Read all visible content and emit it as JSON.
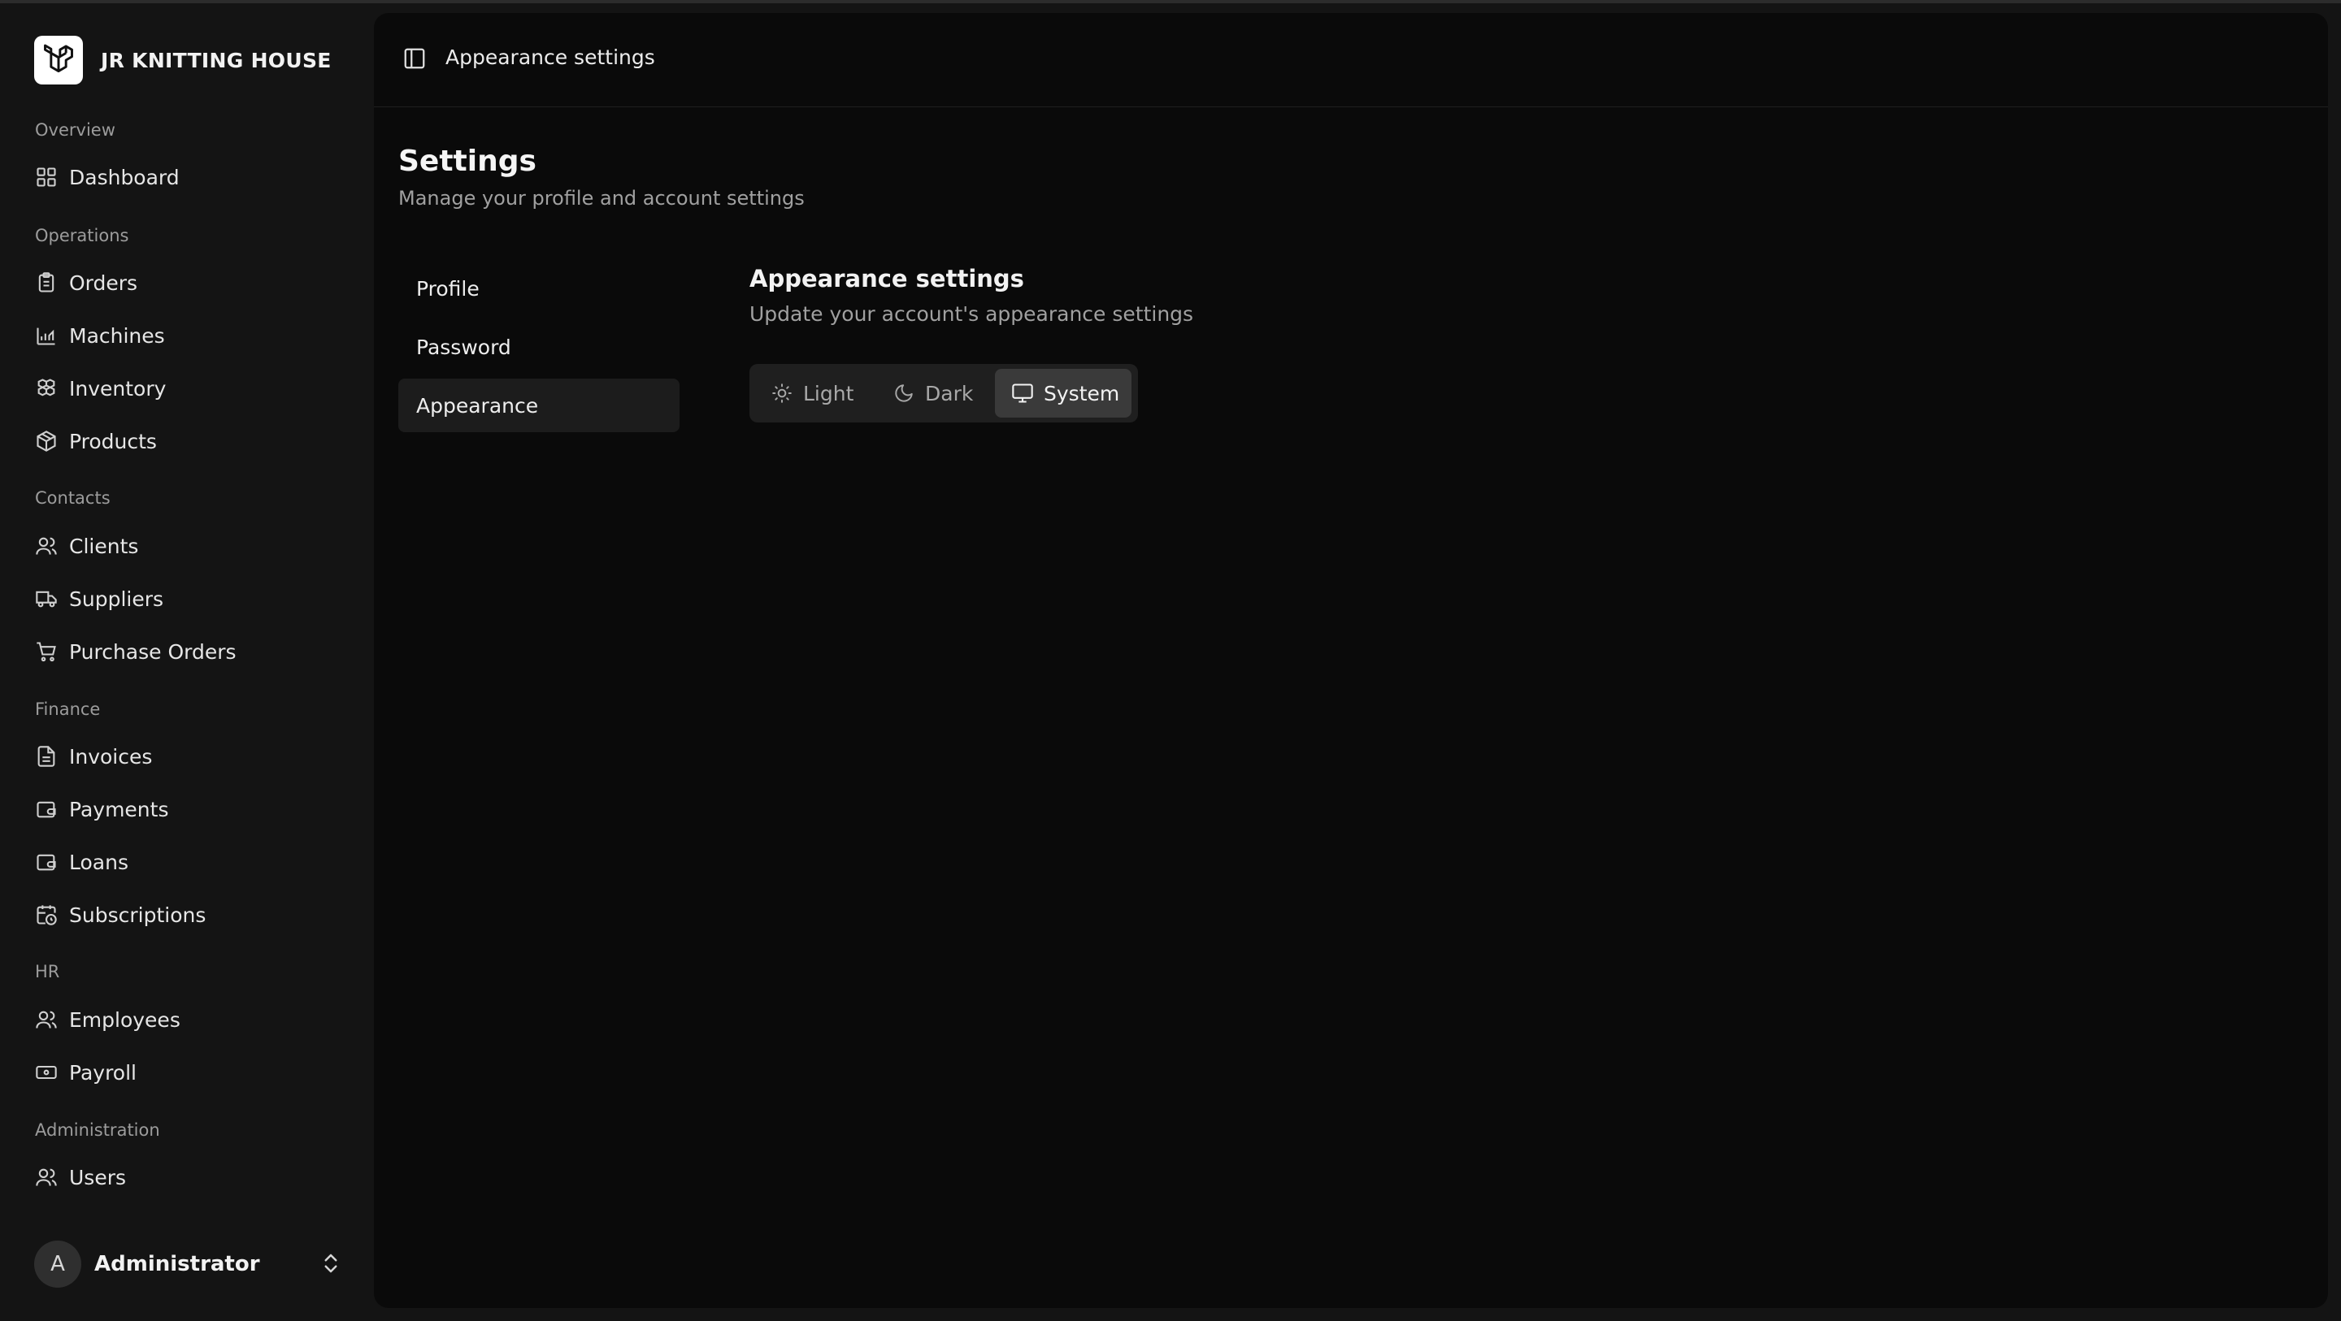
{
  "brand": {
    "name": "JR KNITTING HOUSE"
  },
  "sidebar": {
    "sections": [
      {
        "label": "Overview",
        "items": [
          {
            "label": "Dashboard",
            "icon": "grid-icon"
          }
        ]
      },
      {
        "label": "Operations",
        "items": [
          {
            "label": "Orders",
            "icon": "clipboard-icon"
          },
          {
            "label": "Machines",
            "icon": "factory-icon"
          },
          {
            "label": "Inventory",
            "icon": "boxes-icon"
          },
          {
            "label": "Products",
            "icon": "package-icon"
          }
        ]
      },
      {
        "label": "Contacts",
        "items": [
          {
            "label": "Clients",
            "icon": "users-icon"
          },
          {
            "label": "Suppliers",
            "icon": "truck-icon"
          },
          {
            "label": "Purchase Orders",
            "icon": "cart-icon"
          }
        ]
      },
      {
        "label": "Finance",
        "items": [
          {
            "label": "Invoices",
            "icon": "file-text-icon"
          },
          {
            "label": "Payments",
            "icon": "wallet-icon"
          },
          {
            "label": "Loans",
            "icon": "wallet-icon"
          },
          {
            "label": "Subscriptions",
            "icon": "calendar-clock-icon"
          }
        ]
      },
      {
        "label": "HR",
        "items": [
          {
            "label": "Employees",
            "icon": "users-icon"
          },
          {
            "label": "Payroll",
            "icon": "banknote-icon"
          }
        ]
      },
      {
        "label": "Administration",
        "items": [
          {
            "label": "Users",
            "icon": "users-icon"
          }
        ]
      }
    ]
  },
  "user": {
    "initial": "A",
    "name": "Administrator"
  },
  "header": {
    "breadcrumb": "Appearance settings"
  },
  "page": {
    "title": "Settings",
    "subtitle": "Manage your profile and account settings"
  },
  "settings_nav": {
    "items": [
      {
        "label": "Profile",
        "active": false
      },
      {
        "label": "Password",
        "active": false
      },
      {
        "label": "Appearance",
        "active": true
      }
    ]
  },
  "appearance": {
    "title": "Appearance settings",
    "subtitle": "Update your account's appearance settings",
    "options": [
      {
        "label": "Light",
        "icon": "sun-icon",
        "selected": false
      },
      {
        "label": "Dark",
        "icon": "moon-icon",
        "selected": false
      },
      {
        "label": "System",
        "icon": "monitor-icon",
        "selected": true
      }
    ]
  }
}
